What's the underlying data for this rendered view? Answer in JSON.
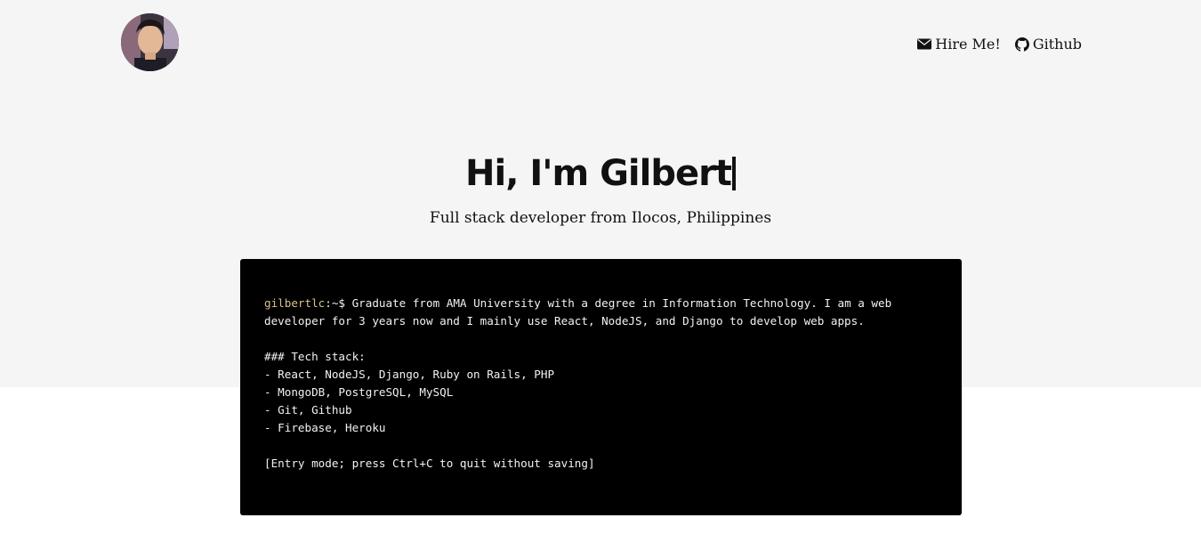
{
  "header": {
    "avatar_alt": "Gilbert profile photo",
    "nav": [
      {
        "label": "Hire Me!",
        "icon": "envelope-icon"
      },
      {
        "label": "Github",
        "icon": "github-icon"
      }
    ]
  },
  "hero": {
    "title": "Hi, I'm Gilbert",
    "subtitle": "Full stack developer from Ilocos, Philippines"
  },
  "terminal": {
    "prompt_user": "gilbertlc",
    "prompt_rest": ":~$ ",
    "intro": "Graduate from AMA University with a degree in Information Technology. I am a web developer for 3 years now and I mainly use React, NodeJS, and Django to develop web apps.",
    "stack_heading": "### Tech stack:",
    "stack": [
      "- React, NodeJS, Django, Ruby on Rails, PHP",
      "- MongoDB, PostgreSQL, MySQL",
      "- Git, Github",
      "- Firebase, Heroku"
    ],
    "footer": "[Entry mode; press Ctrl+C to quit without saving]"
  },
  "colors": {
    "hero_bg": "#f5f5f5",
    "terminal_bg": "#000000",
    "prompt_user": "#d8c08c",
    "text": "#111111"
  }
}
